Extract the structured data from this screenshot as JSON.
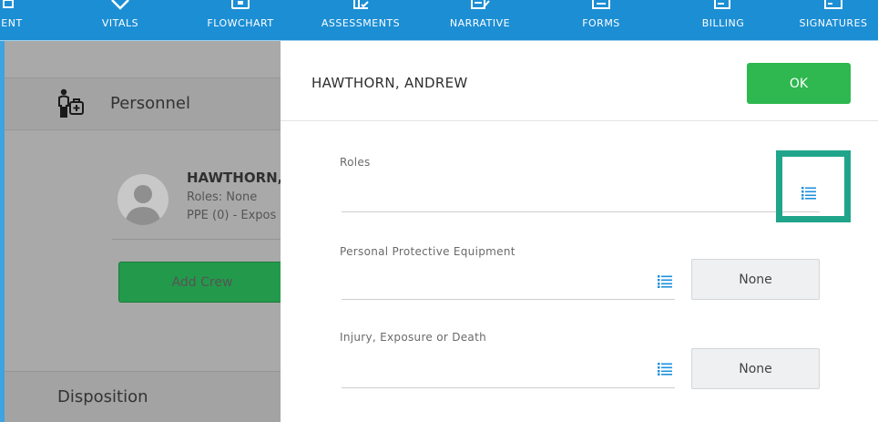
{
  "nav": {
    "tabs": [
      {
        "label": "ENT",
        "icon": "partial-icon"
      },
      {
        "label": "VITALS",
        "icon": "vitals-icon"
      },
      {
        "label": "FLOWCHART",
        "icon": "flowchart-icon"
      },
      {
        "label": "ASSESSMENTS",
        "icon": "assessments-icon"
      },
      {
        "label": "NARRATIVE",
        "icon": "narrative-icon"
      },
      {
        "label": "FORMS",
        "icon": "forms-icon"
      },
      {
        "label": "BILLING",
        "icon": "billing-icon"
      },
      {
        "label": "SIGNATURES",
        "icon": "signatures-icon"
      }
    ]
  },
  "left": {
    "personnel_title": "Personnel",
    "crew": {
      "name": "HAWTHORN,",
      "roles": "Roles: None",
      "ppe": "PPE (0) - Expos"
    },
    "add_crew_label": "Add Crew",
    "disposition_title": "Disposition"
  },
  "dialog": {
    "title": "HAWTHORN, ANDREW",
    "ok_label": "OK",
    "fields": [
      {
        "label": "Roles",
        "value": ""
      },
      {
        "label": "Personal Protective Equipment",
        "value": "None"
      },
      {
        "label": "Injury, Exposure or Death",
        "value": "None"
      }
    ]
  },
  "colors": {
    "nav_blue": "#1c8ed4",
    "ok_green": "#2eb84f",
    "add_crew_green": "#239a4b",
    "highlight_teal": "#20a58b",
    "list_icon_blue": "#1e90dc",
    "overlay_gray": "#a9a9a9"
  }
}
